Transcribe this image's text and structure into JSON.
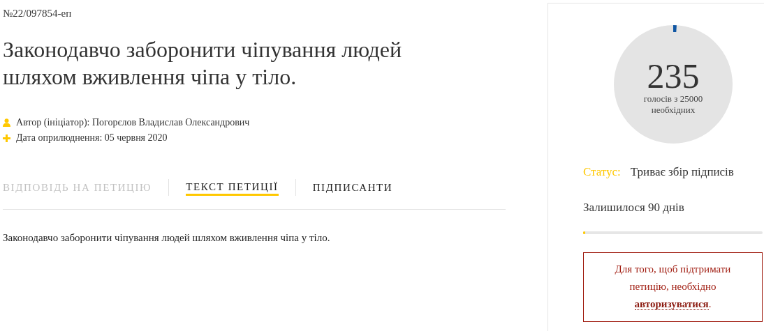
{
  "petition": {
    "number": "№22/097854-еп",
    "title": "Законодавчо заборонити чіпування людей шляхом вживлення чіпа у тіло.",
    "meta": [
      {
        "kind": "author",
        "text": "Автор (ініціатор): Погорєлов Владислав Олександрович"
      },
      {
        "kind": "date",
        "text": "Дата оприлюднення: 05 червня 2020"
      }
    ]
  },
  "tabs": [
    {
      "label": "ВІДПОВІДЬ НА ПЕТИЦІЮ",
      "selected": false,
      "disabled": true
    },
    {
      "label": "ТЕКСТ ПЕТИЦІЇ",
      "selected": true,
      "disabled": false
    },
    {
      "label": "ПІДПИСАНТИ",
      "selected": false,
      "disabled": false
    }
  ],
  "body": "Законодавчо заборонити чіпування людей шляхом вживлення чіпа у тіло.",
  "votes": {
    "count": "235",
    "caption": "голосів з 25000 необхідних"
  },
  "status": {
    "label": "Статус:",
    "value": "Триває збір підписів"
  },
  "remaining": {
    "text": "Залишилося 90 днів",
    "level": 0.01
  },
  "notice": {
    "text": "Для того, щоб підтримати петицію, необхідно ",
    "link": "авторизуватися",
    "after": "."
  }
}
